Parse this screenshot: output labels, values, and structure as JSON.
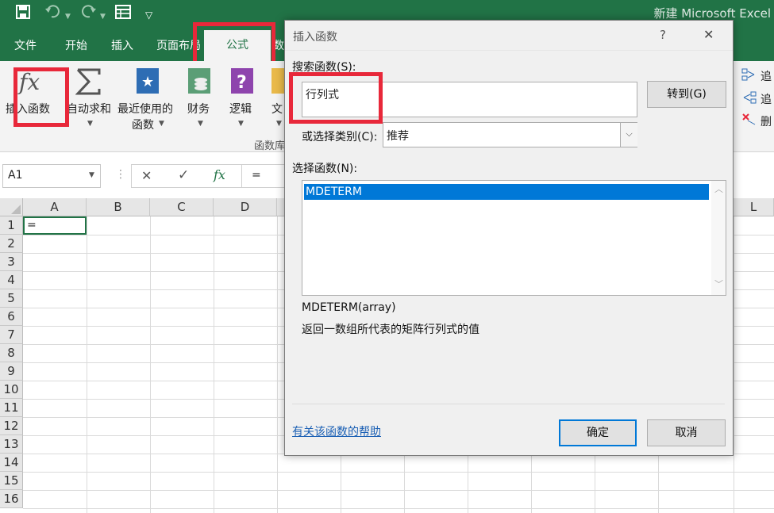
{
  "window": {
    "title": "新建 Microsoft Excel"
  },
  "quick_access": {
    "icons": [
      "save-icon",
      "undo-icon",
      "redo-icon",
      "table-icon",
      "customize-icon"
    ]
  },
  "ribbon_tabs": [
    "文件",
    "开始",
    "插入",
    "页面布局",
    "公式",
    "数"
  ],
  "active_tab": "公式",
  "ribbon": {
    "insert_function": "插入函数",
    "autosum": "自动求和",
    "recent_line1": "最近使用的",
    "recent_line2": "函数",
    "finance": "财务",
    "logic": "逻辑",
    "text": "文",
    "group_label": "函数库",
    "trace_1": "追",
    "trace_2": "追",
    "remove": "删"
  },
  "formula_bar": {
    "name_box": "A1",
    "cancel": "✕",
    "enter": "✓",
    "fx": "fx",
    "content": "="
  },
  "grid": {
    "columns": [
      "A",
      "B",
      "C",
      "D",
      "L"
    ],
    "rows": [
      "1",
      "2",
      "3",
      "4",
      "5",
      "6",
      "7",
      "8",
      "9",
      "10",
      "11",
      "12",
      "13",
      "14",
      "15",
      "16"
    ],
    "cell_a1": "="
  },
  "dialog": {
    "title": "插入函数",
    "help": "?",
    "close": "✕",
    "search_label": "搜索函数(S):",
    "search_value": "行列式",
    "goto_button": "转到(G)",
    "category_label": "或选择类别(C):",
    "category_value": "推荐",
    "select_label": "选择函数(N):",
    "functions": [
      "MDETERM"
    ],
    "signature": "MDETERM(array)",
    "description": "返回一数组所代表的矩阵行列式的值",
    "help_link": "有关该函数的帮助",
    "ok_button": "确定",
    "cancel_button": "取消"
  },
  "colors": {
    "excel_green": "#217346",
    "highlight": "#0078d7",
    "annotation": "#e8283a"
  }
}
